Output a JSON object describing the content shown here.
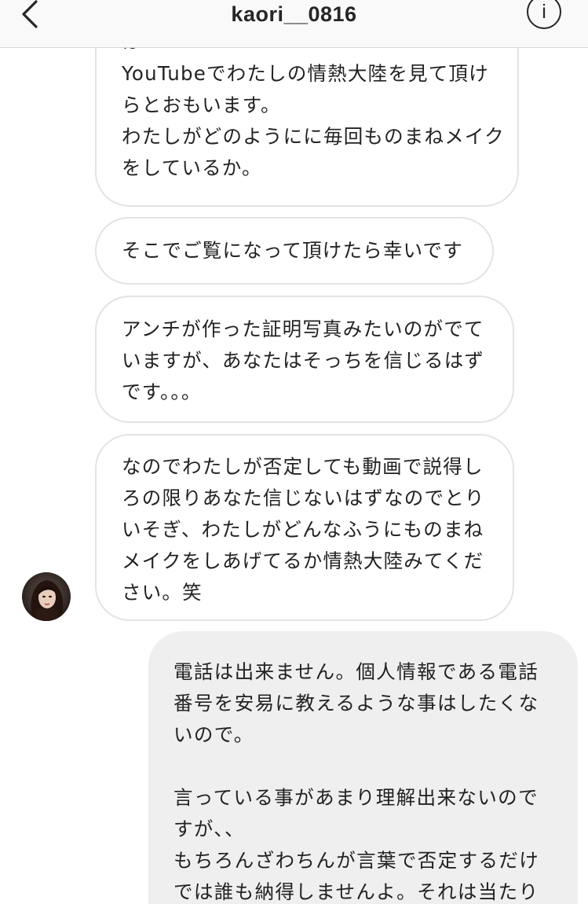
{
  "header": {
    "title": "kaori__0816",
    "info_label": "i"
  },
  "messages": [
    {
      "from": "them",
      "lines": [
        "は",
        "YouTubeでわたしの情熱大陸を見て頂け",
        "らとおもいます。",
        "わたしがどのようにに毎回ものまねメイク",
        "をしているか。"
      ]
    },
    {
      "from": "them",
      "lines": [
        "そこでご覧になって頂けたら幸いです"
      ]
    },
    {
      "from": "them",
      "lines": [
        "アンチが作った証明写真みたいのがでて",
        "いますが、あなたはそっちを信じるはず",
        "です。。。"
      ]
    },
    {
      "from": "them",
      "lines": [
        "なのでわたしが否定しても動画で説得し",
        "ろの限りあなた信じないはずなのでとり",
        "いそぎ、わたしがどんなふうにものまね",
        "メイクをしあげてるか情熱大陸みてくだ",
        "さい。笑"
      ]
    },
    {
      "from": "me",
      "lines": [
        "電話は出来ません。個人情報である電話",
        "番号を安易に教えるような事はしたくな",
        "いので。",
        "",
        "言っている事があまり理解出来ないので",
        "すが、、",
        "もちろんざわちんが言葉で否定するだけ",
        "では誰も納得しませんよ。それは当たり"
      ]
    }
  ]
}
